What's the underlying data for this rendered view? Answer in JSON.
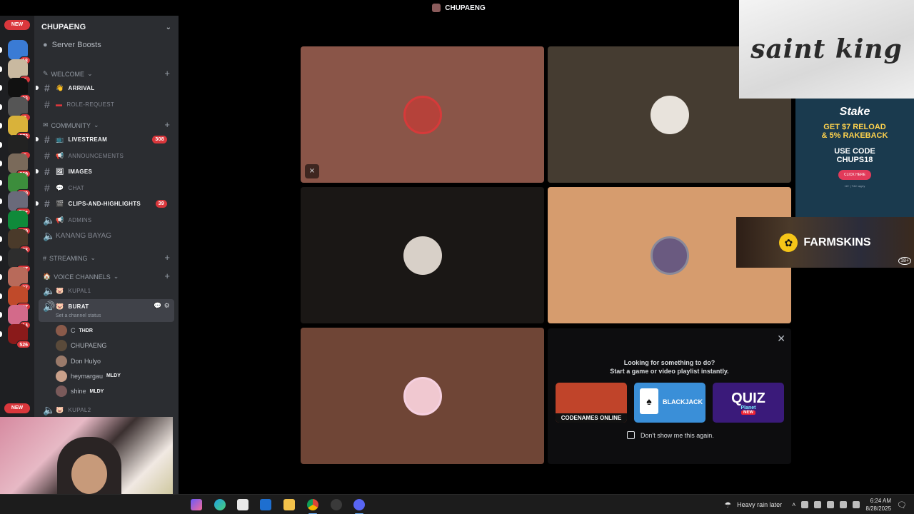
{
  "window": {
    "title": "CHUPAENG"
  },
  "rail": {
    "new_top": "NEW",
    "new_bottom": "NEW",
    "servers": [
      {
        "badge": "18",
        "color": "#3a7bd5"
      },
      {
        "badge": "1",
        "color": "#c9b9a0"
      },
      {
        "badge": "93",
        "color": "#111111"
      },
      {
        "badge": "3",
        "color": "#555555"
      },
      {
        "badge": "972",
        "color": "#d9b23a"
      },
      {
        "badge": "5",
        "color": "#222222"
      },
      {
        "badge": "369",
        "color": "#7a6a5a"
      },
      {
        "badge": "349",
        "color": "#3c8d3c"
      },
      {
        "badge": "6K+",
        "color": "#6a6a7a"
      },
      {
        "badge": "229",
        "color": "#0f8a3a"
      },
      {
        "badge": "33",
        "color": "#4a3a2a"
      },
      {
        "badge": "127",
        "color": "#2d2d2d"
      },
      {
        "badge": "87",
        "color": "#b86a5a"
      },
      {
        "badge": "587",
        "color": "#c04a2a"
      },
      {
        "badge": "14",
        "color": "#d36a8a"
      },
      {
        "badge": "526",
        "color": "#8a1a1a"
      }
    ]
  },
  "sidebar": {
    "guild_name": "CHUPAENG",
    "server_boosts": "Server Boosts",
    "categories": {
      "welcome": "WELCOME",
      "community": "COMMUNITY",
      "streaming": "STREAMING",
      "voice": "VOICE CHANNELS"
    },
    "channels": {
      "arrival": "ARRIVAL",
      "role_request": "ROLE-REQUEST",
      "livestream": "LIVESTREAM",
      "livestream_badge": "308",
      "announcements": "ANNOUNCEMENTS",
      "images": "IMAGES",
      "chat": "CHAT",
      "clips": "CLIPS-AND-HIGHLIGHTS",
      "clips_badge": "39",
      "admins": "ADMINS",
      "kanang_bayag": "KANANG BAYAG",
      "kupal1": "KUPAL1",
      "burat": "BURAT",
      "burat_status": "Set a channel status",
      "kupal2": "KUPAL2"
    },
    "voice_members": [
      {
        "name": "C",
        "tag": "THDR"
      },
      {
        "name": "CHUPAENG",
        "tag": ""
      },
      {
        "name": "Don Hulyo",
        "tag": ""
      },
      {
        "name": "heymargau",
        "tag": "MLDY"
      },
      {
        "name": "shine",
        "tag": "MLDY"
      }
    ]
  },
  "stage": {
    "tiles": [
      {
        "bg": "#8a5548",
        "avatar": "#b5423a"
      },
      {
        "bg": "#453c31",
        "avatar": "#e8e3dc"
      },
      {
        "bg": "#1a1715",
        "avatar": "#d8d0c8"
      },
      {
        "bg": "#d69c6e",
        "avatar": "#6a5a80"
      },
      {
        "bg": "#6f4536",
        "avatar": "#f0c8d0"
      }
    ]
  },
  "activity": {
    "title_line1": "Looking for something to do?",
    "title_line2": "Start a game or video playlist instantly.",
    "cards": [
      {
        "label": "CODENAMES ONLINE",
        "color": "#c0442a"
      },
      {
        "label": "BLACKJACK",
        "color": "#3a8fd8"
      },
      {
        "label": "QUIZ",
        "color": "#3a1a7a"
      }
    ],
    "quiz_sub": "Planet",
    "quiz_new": "NEW",
    "dont_show": "Don't show me this again."
  },
  "ads": {
    "saint_king": "saint king",
    "stake_brand": "Stake",
    "stake_offer1": "GET $7 RELOAD",
    "stake_offer2": "& 5% RAKEBACK",
    "stake_use": "USE CODE",
    "stake_code": "CHUPS18",
    "stake_cta": "CLICK HERE",
    "stake_fine": "18+ | T&C apply",
    "farmskins": "FARMSKINS",
    "farmskins_age": "18+"
  },
  "taskbar": {
    "weather": "Heavy rain later",
    "time": "6:24 AM",
    "date": "8/28/2025"
  }
}
